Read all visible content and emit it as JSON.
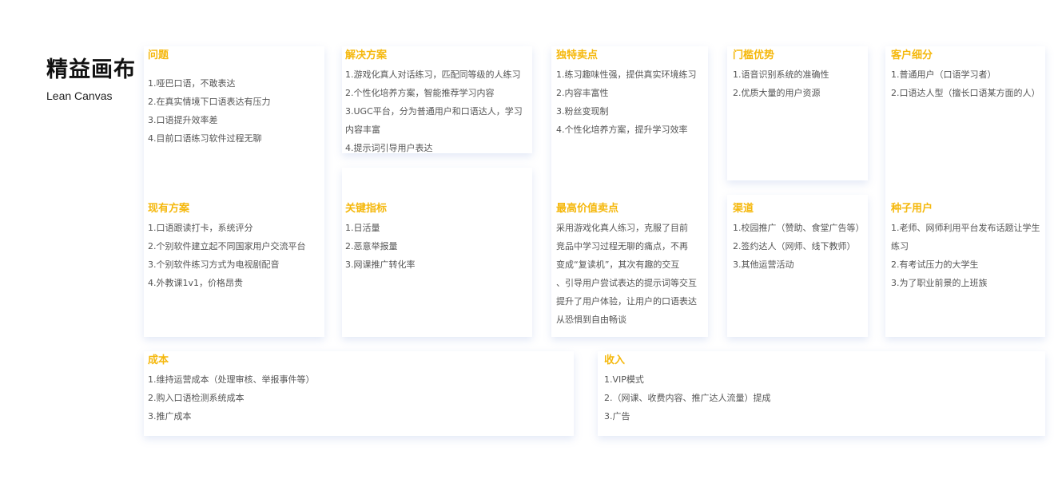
{
  "header": {
    "title": "精益画布",
    "subtitle": "Lean Canvas"
  },
  "sections": {
    "problem": {
      "title": "问题",
      "items": [
        "1.哑巴口语，不敢表达",
        "2.在真实情境下口语表达有压力",
        "3.口语提升效率差",
        "4.目前口语练习软件过程无聊"
      ]
    },
    "solution": {
      "title": "解决方案",
      "items": [
        "1.游戏化真人对话练习，匹配同等级的人练习",
        "2.个性化培养方案，智能推荐学习内容",
        "3.UGC平台，分为普通用户和口语达人，学习",
        "内容丰富",
        "4.提示词引导用户表达"
      ]
    },
    "uvp": {
      "title": "独特卖点",
      "items": [
        "1.练习趣味性强，提供真实环境练习",
        "2.内容丰富性",
        "3.粉丝变现制",
        "4.个性化培养方案，提升学习效率"
      ]
    },
    "unfair_advantage": {
      "title": "门槛优势",
      "items": [
        "1.语音识别系统的准确性",
        "2.优质大量的用户资源"
      ]
    },
    "customer_segments": {
      "title": "客户细分",
      "items": [
        "1.普通用户（口语学习者）",
        "2.口语达人型（擅长口语某方面的人）"
      ]
    },
    "existing_alternatives": {
      "title": "现有方案",
      "items": [
        "1.口语跟读打卡，系统评分",
        "2.个别软件建立起不同国家用户交流平台",
        "3.个别软件练习方式为电视剧配音",
        "4.外教课1v1，价格昂贵"
      ]
    },
    "key_metrics": {
      "title": "关键指标",
      "items": [
        "1.日活量",
        "2.恶意举报量",
        "3.网课推广转化率"
      ]
    },
    "high_level_concept": {
      "title": "最高价值卖点",
      "lines": [
        "采用游戏化真人练习，克服了目前",
        "竞品中学习过程无聊的痛点，不再",
        "变成“复读机”，其次有趣的交互",
        "、引导用户尝试表达的提示词等交互",
        "提升了用户体验，让用户的口语表达",
        "从恐惧到自由畅谈"
      ]
    },
    "channels": {
      "title": "渠道",
      "items": [
        "1.校园推广（赞助、食堂广告等）",
        "2.签约达人（网师、线下教师）",
        "3.其他运营活动"
      ]
    },
    "early_adopters": {
      "title": "种子用户",
      "items": [
        "1.老师、网师利用平台发布话题让学生",
        "练习",
        "2.有考试压力的大学生",
        "3.为了职业前景的上班族"
      ]
    },
    "cost": {
      "title": "成本",
      "items": [
        "1.维持运营成本（处理审核、举报事件等）",
        "2.购入口语检测系统成本",
        "3.推广成本"
      ]
    },
    "revenue": {
      "title": "收入",
      "items": [
        "1.VIP模式",
        "2.（网课、收费内容、推广达人流量）提成",
        "3.广告"
      ]
    }
  },
  "colors": {
    "accent": "#f5b80d",
    "title": "#111111",
    "text": "#555555",
    "card_bg": "#ffffff"
  }
}
